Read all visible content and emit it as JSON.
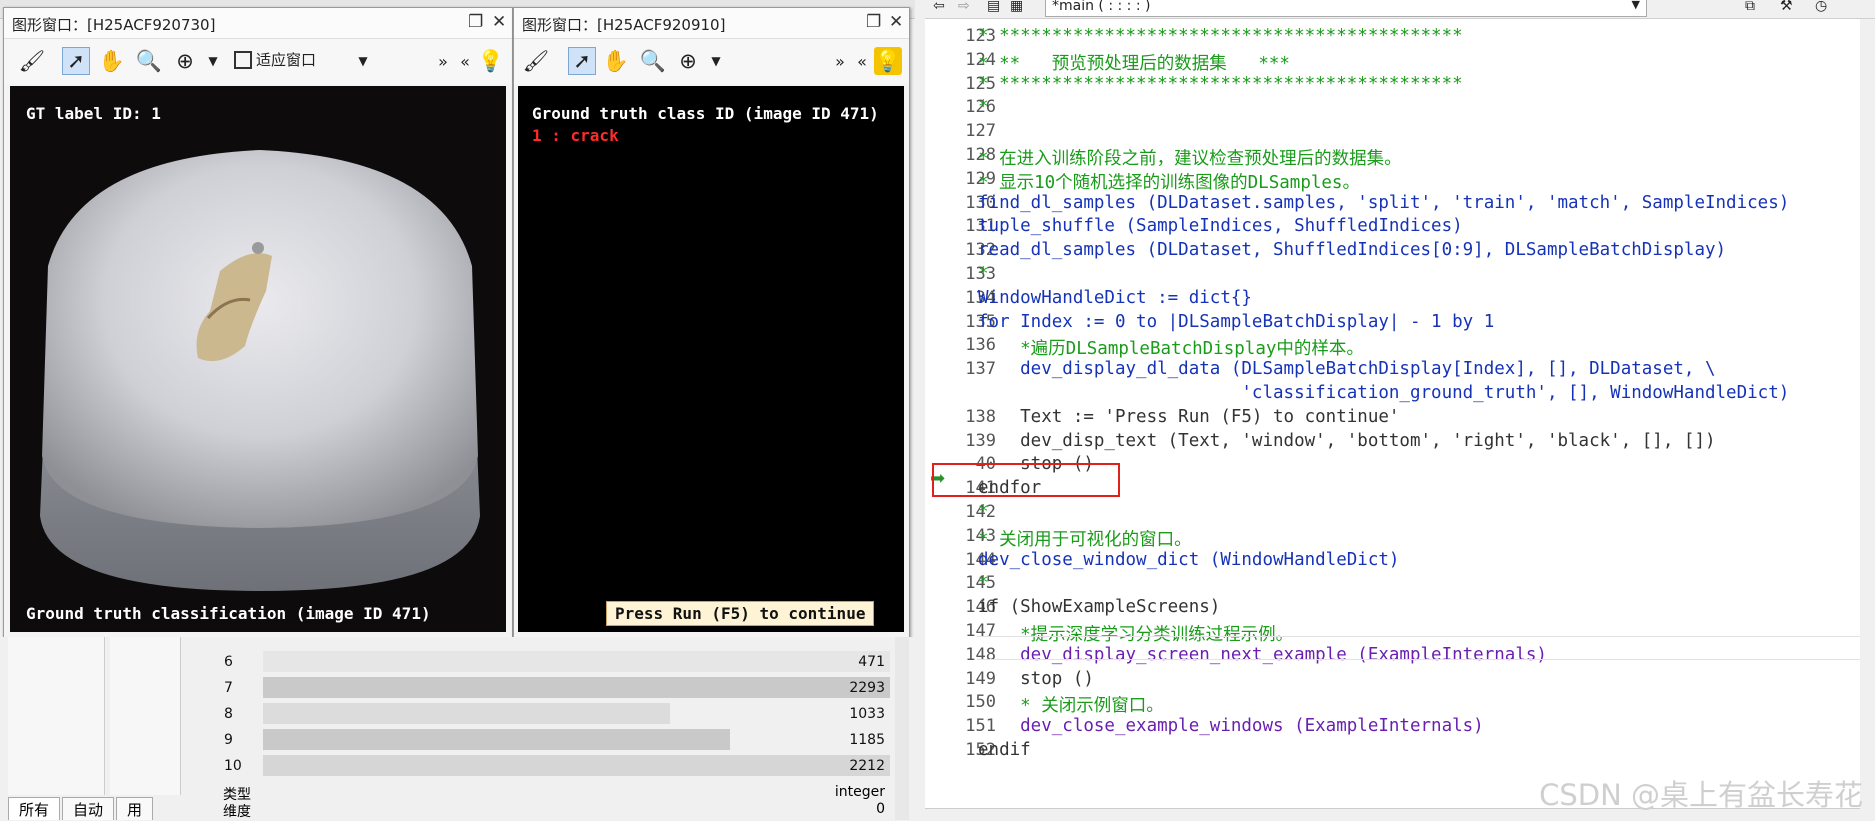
{
  "graphics_windows": [
    {
      "title": "图形窗口：[H25ACF920730]",
      "fit_label": "适应窗口",
      "overlay_top": "GT label ID: 1",
      "overlay_bottom": "Ground truth classification (image ID 471)"
    },
    {
      "title": "图形窗口：[H25ACF920910]",
      "overlay_top": "Ground truth class ID (image ID 471)",
      "overlay_class": "1 : crack",
      "press_text": "Press Run (F5) to continue"
    }
  ],
  "variable_table": {
    "rows": [
      {
        "index": "6",
        "value": "471"
      },
      {
        "index": "7",
        "value": "2293"
      },
      {
        "index": "8",
        "value": "1033"
      },
      {
        "index": "9",
        "value": "1185"
      },
      {
        "index": "10",
        "value": "2212"
      }
    ],
    "type_label": "类型",
    "type_value": "integer",
    "dim_label": "维度",
    "dim_value": "0"
  },
  "left_tabs": [
    "所有",
    "自动",
    "用"
  ],
  "editor": {
    "procedure_selector": "*main ( : : : : )",
    "current_line": "140",
    "lines": [
      {
        "n": "123",
        "text": "* ********************************************",
        "color": "green"
      },
      {
        "n": "124",
        "text": "* **   预览预处理后的数据集   ***",
        "color": "green"
      },
      {
        "n": "125",
        "text": "* ********************************************",
        "color": "green"
      },
      {
        "n": "126",
        "text": "*",
        "color": "green"
      },
      {
        "n": "127",
        "text": "",
        "color": "green"
      },
      {
        "n": "128",
        "text": "* 在进入训练阶段之前，建议检查预处理后的数据集。",
        "color": "green"
      },
      {
        "n": "129",
        "text": "* 显示10个随机选择的训练图像的DLSamples。",
        "color": "green"
      },
      {
        "n": "130",
        "text": "find_dl_samples (DLDataset.samples, 'split', 'train', 'match', SampleIndices)",
        "color": "blue"
      },
      {
        "n": "131",
        "text": "tuple_shuffle (SampleIndices, ShuffledIndices)",
        "color": "blue"
      },
      {
        "n": "132",
        "text": "read_dl_samples (DLDataset, ShuffledIndices[0:9], DLSampleBatchDisplay)",
        "color": "blue"
      },
      {
        "n": "133",
        "text": "*",
        "color": "green"
      },
      {
        "n": "134",
        "text": "WindowHandleDict := dict{}",
        "color": "blue"
      },
      {
        "n": "135",
        "text": "for Index := 0 to |DLSampleBatchDisplay| - 1 by 1",
        "color": "blue"
      },
      {
        "n": "136",
        "text": "    *遍历DLSampleBatchDisplay中的样本。",
        "color": "green"
      },
      {
        "n": "137",
        "text": "    dev_display_dl_data (DLSampleBatchDisplay[Index], [], DLDataset, \\",
        "color": "blue"
      },
      {
        "n": "",
        "text": "                         'classification_ground_truth', [], WindowHandleDict)",
        "color": "blue"
      },
      {
        "n": "138",
        "text": "    Text := 'Press Run (F5) to continue'",
        "color": "dark"
      },
      {
        "n": "139",
        "text": "    dev_disp_text (Text, 'window', 'bottom', 'right', 'black', [], [])",
        "color": "dark"
      },
      {
        "n": "40",
        "text": "    stop ()",
        "color": "dark"
      },
      {
        "n": "141",
        "text": "endfor",
        "color": "dark"
      },
      {
        "n": "142",
        "text": "*",
        "color": "green"
      },
      {
        "n": "143",
        "text": "* 关闭用于可视化的窗口。",
        "color": "green"
      },
      {
        "n": "144",
        "text": "dev_close_window_dict (WindowHandleDict)",
        "color": "blue"
      },
      {
        "n": "145",
        "text": "*",
        "color": "green"
      },
      {
        "n": "146",
        "text": "if (ShowExampleScreens)",
        "color": "dark"
      },
      {
        "n": "147",
        "text": "    *提示深度学习分类训练过程示例。",
        "color": "green"
      },
      {
        "n": "148",
        "text": "    dev_display_screen_next_example (ExampleInternals)",
        "color": "purple"
      },
      {
        "n": "149",
        "text": "    stop ()",
        "color": "dark"
      },
      {
        "n": "150",
        "text": "    * 关闭示例窗口。",
        "color": "green"
      },
      {
        "n": "151",
        "text": "    dev_close_example_windows (ExampleInternals)",
        "color": "purple"
      },
      {
        "n": "152",
        "text": "endif",
        "color": "dark"
      }
    ]
  },
  "watermark": "CSDN @桌上有盆长寿花",
  "colors": {
    "comment": "#1a9c1a",
    "operator": "#1633b8",
    "procedure": "#6a1fb0",
    "highlight_box": "#e0201a",
    "bulb": "#f5c400"
  }
}
